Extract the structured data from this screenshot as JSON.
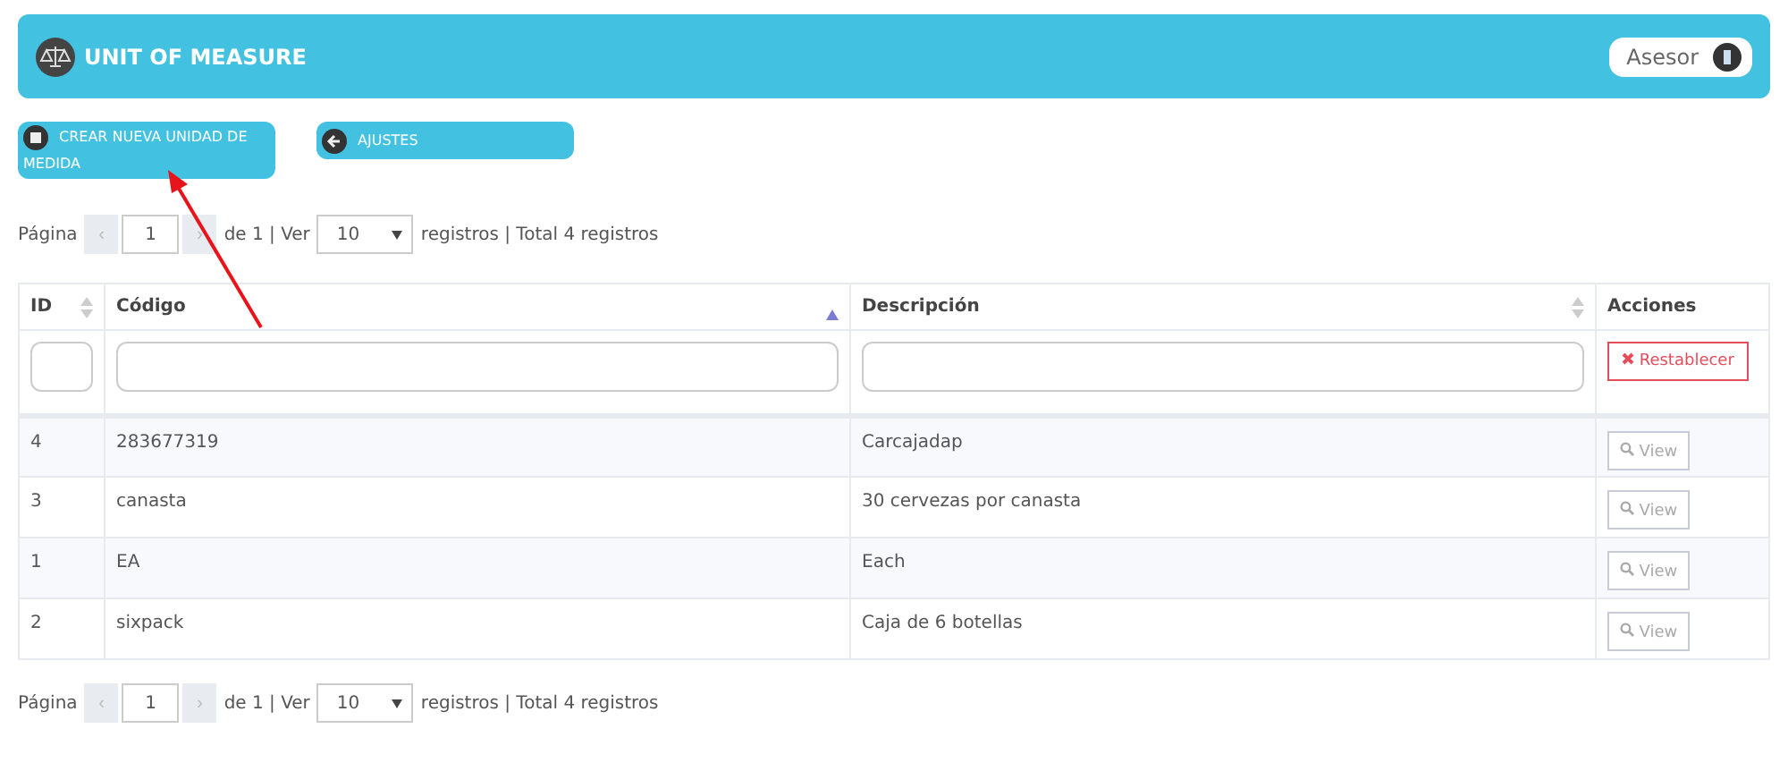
{
  "header": {
    "title": "UNIT OF MEASURE",
    "user_button": "Asesor"
  },
  "actions": [
    {
      "kind": "plus",
      "label": "CREAR NUEVA UNIDAD DE MEDIDA"
    },
    {
      "kind": "back",
      "label": "AJUSTES"
    }
  ],
  "pager_top": {
    "label": "Página",
    "previous": "‹",
    "page": "1",
    "next": "›",
    "of": "de 1 | Ver",
    "page_size": "10",
    "summary": "registros | Total 4 registros"
  },
  "table": {
    "columns": [
      {
        "label": "ID",
        "kind": "sortable"
      },
      {
        "label": "Código",
        "kind": "sorted"
      },
      {
        "label": "Descripción",
        "kind": "sortable"
      },
      {
        "label": "Acciones",
        "kind": "actions"
      }
    ],
    "reset_button": "Restablecer",
    "rows": [
      {
        "id": "4",
        "code": "283677319",
        "description": "Carcajadap",
        "action": "View"
      },
      {
        "id": "3",
        "code": "canasta",
        "description": "30 cervezas por canasta",
        "action": "View"
      },
      {
        "id": "1",
        "code": "EA",
        "description": "Each",
        "action": "View"
      },
      {
        "id": "2",
        "code": "sixpack",
        "description": "Caja de 6 botellas",
        "action": "View"
      }
    ]
  },
  "pager_bottom": {
    "label": "Página",
    "previous": "‹",
    "page": "1",
    "next": "›",
    "of": "de 1 | Ver",
    "page_size": "10",
    "summary": "registros | Total 4 registros"
  }
}
